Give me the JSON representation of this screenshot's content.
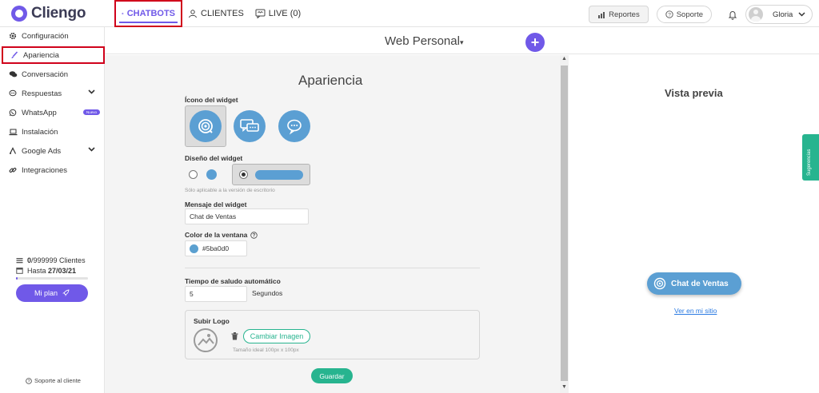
{
  "header": {
    "logo_text": "Cliengo",
    "tabs": [
      {
        "label": "CHATBOTS"
      },
      {
        "label": "CLIENTES"
      },
      {
        "label": "LIVE (0)"
      }
    ],
    "reports_label": "Reportes",
    "support_label": "Soporte",
    "user_name": "Gloria"
  },
  "sidebar": {
    "items": [
      {
        "label": "Configuración"
      },
      {
        "label": "Apariencia"
      },
      {
        "label": "Conversación"
      },
      {
        "label": "Respuestas"
      },
      {
        "label": "WhatsApp",
        "badge": "Nuevo"
      },
      {
        "label": "Instalación"
      },
      {
        "label": "Google Ads"
      },
      {
        "label": "Integraciones"
      }
    ],
    "plan": {
      "clients_count": "0",
      "clients_total": "/999999 Clientes",
      "until_prefix": "Hasta ",
      "until_date": "27/03/21",
      "progress": 0.02,
      "button_label": "Mi plan"
    },
    "support_link": "Soporte al cliente"
  },
  "main": {
    "bot_name": "Web Personal",
    "add_label": "+"
  },
  "settings": {
    "title": "Apariencia",
    "widget_icon_label": "Ícono del widget",
    "widget_design_label": "Diseño del widget",
    "design_hint": "Sólo aplicable a la versión de escritorio",
    "widget_message_label": "Mensaje del widget",
    "widget_message_value": "Chat de Ventas",
    "window_color_label": "Color de la ventana",
    "window_color_value": "#5ba0d0",
    "greeting_time_label": "Tiempo de saludo automático",
    "greeting_time_value": "5",
    "greeting_time_unit": "Segundos",
    "upload_logo_label": "Subir Logo",
    "change_image_label": "Cambiar Imagen",
    "image_size_hint": "Tamaño ideal 100px x 100px",
    "save_label": "Guardar"
  },
  "preview": {
    "title": "Vista previa",
    "chat_label": "Chat de Ventas",
    "view_site_link": "Ver en mi sitio",
    "suggestions_tab": "Sugerencias"
  },
  "colors": {
    "brand": "#7059e8",
    "widget": "#5b9fd3",
    "success": "#27b48f",
    "highlight": "#d0021b"
  }
}
